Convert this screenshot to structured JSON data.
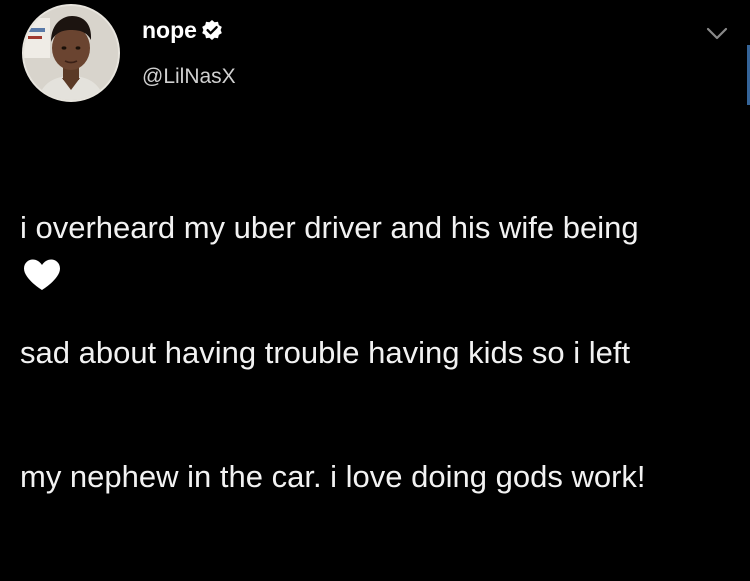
{
  "tweet": {
    "display_name": "nope",
    "handle": "@LilNasX",
    "text_lines": [
      "i overheard my uber driver and his wife being",
      "sad about having trouble having kids so i left",
      "my nephew in the car. i love doing gods work!"
    ],
    "verified": true
  },
  "icons": {
    "verified": "verified-badge-icon",
    "caret": "chevron-down-icon",
    "like": "heart-icon"
  },
  "colors": {
    "background": "#000000",
    "text": "#ffffff",
    "handle": "#d0d0d0",
    "heart": "#ffffff"
  }
}
